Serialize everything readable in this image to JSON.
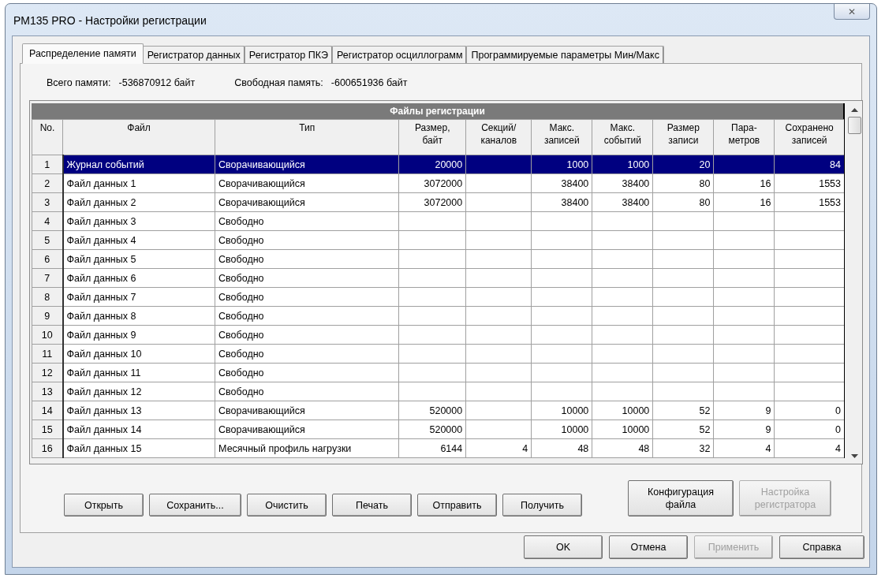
{
  "window": {
    "title": "PM135 PRO - Настройки регистрации",
    "close": "✕"
  },
  "tabs": [
    {
      "label": "Распределение памяти",
      "selected": true
    },
    {
      "label": "Регистратор данных",
      "selected": false
    },
    {
      "label": "Регистратор ПКЭ",
      "selected": false
    },
    {
      "label": "Регистратор осциллограмм",
      "selected": false
    },
    {
      "label": "Программируемые параметры Мин/Макс",
      "selected": false
    }
  ],
  "memory": {
    "total_label": "Всего памяти:",
    "total_value": "-536870912 байт",
    "free_label": "Свободная память:",
    "free_value": "-600651936 байт"
  },
  "table": {
    "title": "Файлы регистрации",
    "columns": [
      {
        "label": "No.",
        "kind": "index"
      },
      {
        "label": "Файл",
        "kind": "text"
      },
      {
        "label": "Тип",
        "kind": "text"
      },
      {
        "label": "Размер,\nбайт",
        "kind": "number"
      },
      {
        "label": "Секций/\nканалов",
        "kind": "number"
      },
      {
        "label": "Макс.\nзаписей",
        "kind": "number"
      },
      {
        "label": "Макс.\nсобытий",
        "kind": "number"
      },
      {
        "label": "Размер\nзаписи",
        "kind": "number"
      },
      {
        "label": "Пара-\nметров",
        "kind": "number"
      },
      {
        "label": "Сохранено\nзаписей",
        "kind": "number"
      }
    ],
    "rows": [
      {
        "selected": true,
        "cells": [
          "1",
          "Журнал событий",
          "Сворачивающийся",
          "20000",
          null,
          "1000",
          "1000",
          "20",
          null,
          "84"
        ]
      },
      {
        "selected": false,
        "cells": [
          "2",
          "Файл данных 1",
          "Сворачивающийся",
          "3072000",
          null,
          "38400",
          "38400",
          "80",
          "16",
          "1553"
        ]
      },
      {
        "selected": false,
        "cells": [
          "3",
          "Файл данных 2",
          "Сворачивающийся",
          "3072000",
          null,
          "38400",
          "38400",
          "80",
          "16",
          "1553"
        ]
      },
      {
        "selected": false,
        "cells": [
          "4",
          "Файл данных 3",
          "Свободно",
          null,
          null,
          null,
          null,
          null,
          null,
          null
        ]
      },
      {
        "selected": false,
        "cells": [
          "5",
          "Файл данных 4",
          "Свободно",
          null,
          null,
          null,
          null,
          null,
          null,
          null
        ]
      },
      {
        "selected": false,
        "cells": [
          "6",
          "Файл данных 5",
          "Свободно",
          null,
          null,
          null,
          null,
          null,
          null,
          null
        ]
      },
      {
        "selected": false,
        "cells": [
          "7",
          "Файл данных 6",
          "Свободно",
          null,
          null,
          null,
          null,
          null,
          null,
          null
        ]
      },
      {
        "selected": false,
        "cells": [
          "8",
          "Файл данных 7",
          "Свободно",
          null,
          null,
          null,
          null,
          null,
          null,
          null
        ]
      },
      {
        "selected": false,
        "cells": [
          "9",
          "Файл данных 8",
          "Свободно",
          null,
          null,
          null,
          null,
          null,
          null,
          null
        ]
      },
      {
        "selected": false,
        "cells": [
          "10",
          "Файл данных 9",
          "Свободно",
          null,
          null,
          null,
          null,
          null,
          null,
          null
        ]
      },
      {
        "selected": false,
        "cells": [
          "11",
          "Файл данных 10",
          "Свободно",
          null,
          null,
          null,
          null,
          null,
          null,
          null
        ]
      },
      {
        "selected": false,
        "cells": [
          "12",
          "Файл данных 11",
          "Свободно",
          null,
          null,
          null,
          null,
          null,
          null,
          null
        ]
      },
      {
        "selected": false,
        "cells": [
          "13",
          "Файл данных 12",
          "Свободно",
          null,
          null,
          null,
          null,
          null,
          null,
          null
        ]
      },
      {
        "selected": false,
        "cells": [
          "14",
          "Файл данных 13",
          "Сворачивающийся",
          "520000",
          null,
          "10000",
          "10000",
          "52",
          "9",
          "0"
        ]
      },
      {
        "selected": false,
        "cells": [
          "15",
          "Файл данных 14",
          "Сворачивающийся",
          "520000",
          null,
          "10000",
          "10000",
          "52",
          "9",
          "0"
        ]
      },
      {
        "selected": false,
        "cells": [
          "16",
          "Файл данных 15",
          "Месячный профиль нагрузки",
          "6144",
          "4",
          "48",
          "48",
          "32",
          "4",
          "4"
        ]
      }
    ]
  },
  "actions": [
    {
      "label": "Открыть",
      "disabled": false
    },
    {
      "label": "Сохранить...",
      "disabled": false
    },
    {
      "label": "Очистить",
      "disabled": false
    },
    {
      "label": "Печать",
      "disabled": false
    },
    {
      "label": "Отправить",
      "disabled": false
    },
    {
      "label": "Получить",
      "disabled": false
    }
  ],
  "file_actions": [
    {
      "label": "Конфигурация\nфайла",
      "disabled": false
    },
    {
      "label": "Настройка\nрегистратора",
      "disabled": true
    }
  ],
  "dialog_buttons": [
    {
      "label": "OK",
      "disabled": false
    },
    {
      "label": "Отмена",
      "disabled": false
    },
    {
      "label": "Применить",
      "disabled": true
    },
    {
      "label": "Справка",
      "disabled": false
    }
  ]
}
